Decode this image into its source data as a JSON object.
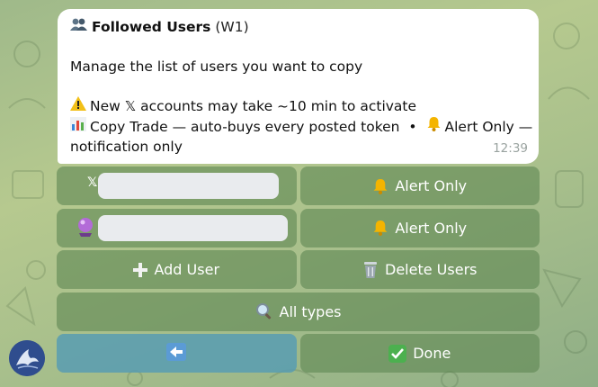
{
  "message": {
    "title_icon": "busts-in-silhouette-icon",
    "title": "Followed Users",
    "wallet": "(W1)",
    "subtitle": "Manage the list of users you want to copy",
    "warning_icon": "warning-icon",
    "warning": "New 𝕏 accounts may take ~10 min to activate",
    "legend_icon": "bar-chart-icon",
    "legend_copy": "Copy Trade — auto-buys every posted token",
    "bullet": "•",
    "legend_alert_icon": "bell-icon",
    "legend_alert_part1": "Alert Only —",
    "legend_alert_part2": "notification only",
    "time": "12:39"
  },
  "keyboard": {
    "user1_icon": "𝕏",
    "user1_mode": "Alert Only",
    "user2_icon": "crystal-ball-icon",
    "user2_mode": "Alert Only",
    "add_user": "Add User",
    "delete_users": "Delete Users",
    "filter": "All types",
    "back_icon": "left-arrow-icon",
    "done": "Done"
  },
  "colors": {
    "button_bg": "#6a8f5c",
    "back_button_bg": "#5a9cb2",
    "bubble_bg": "#ffffff"
  }
}
